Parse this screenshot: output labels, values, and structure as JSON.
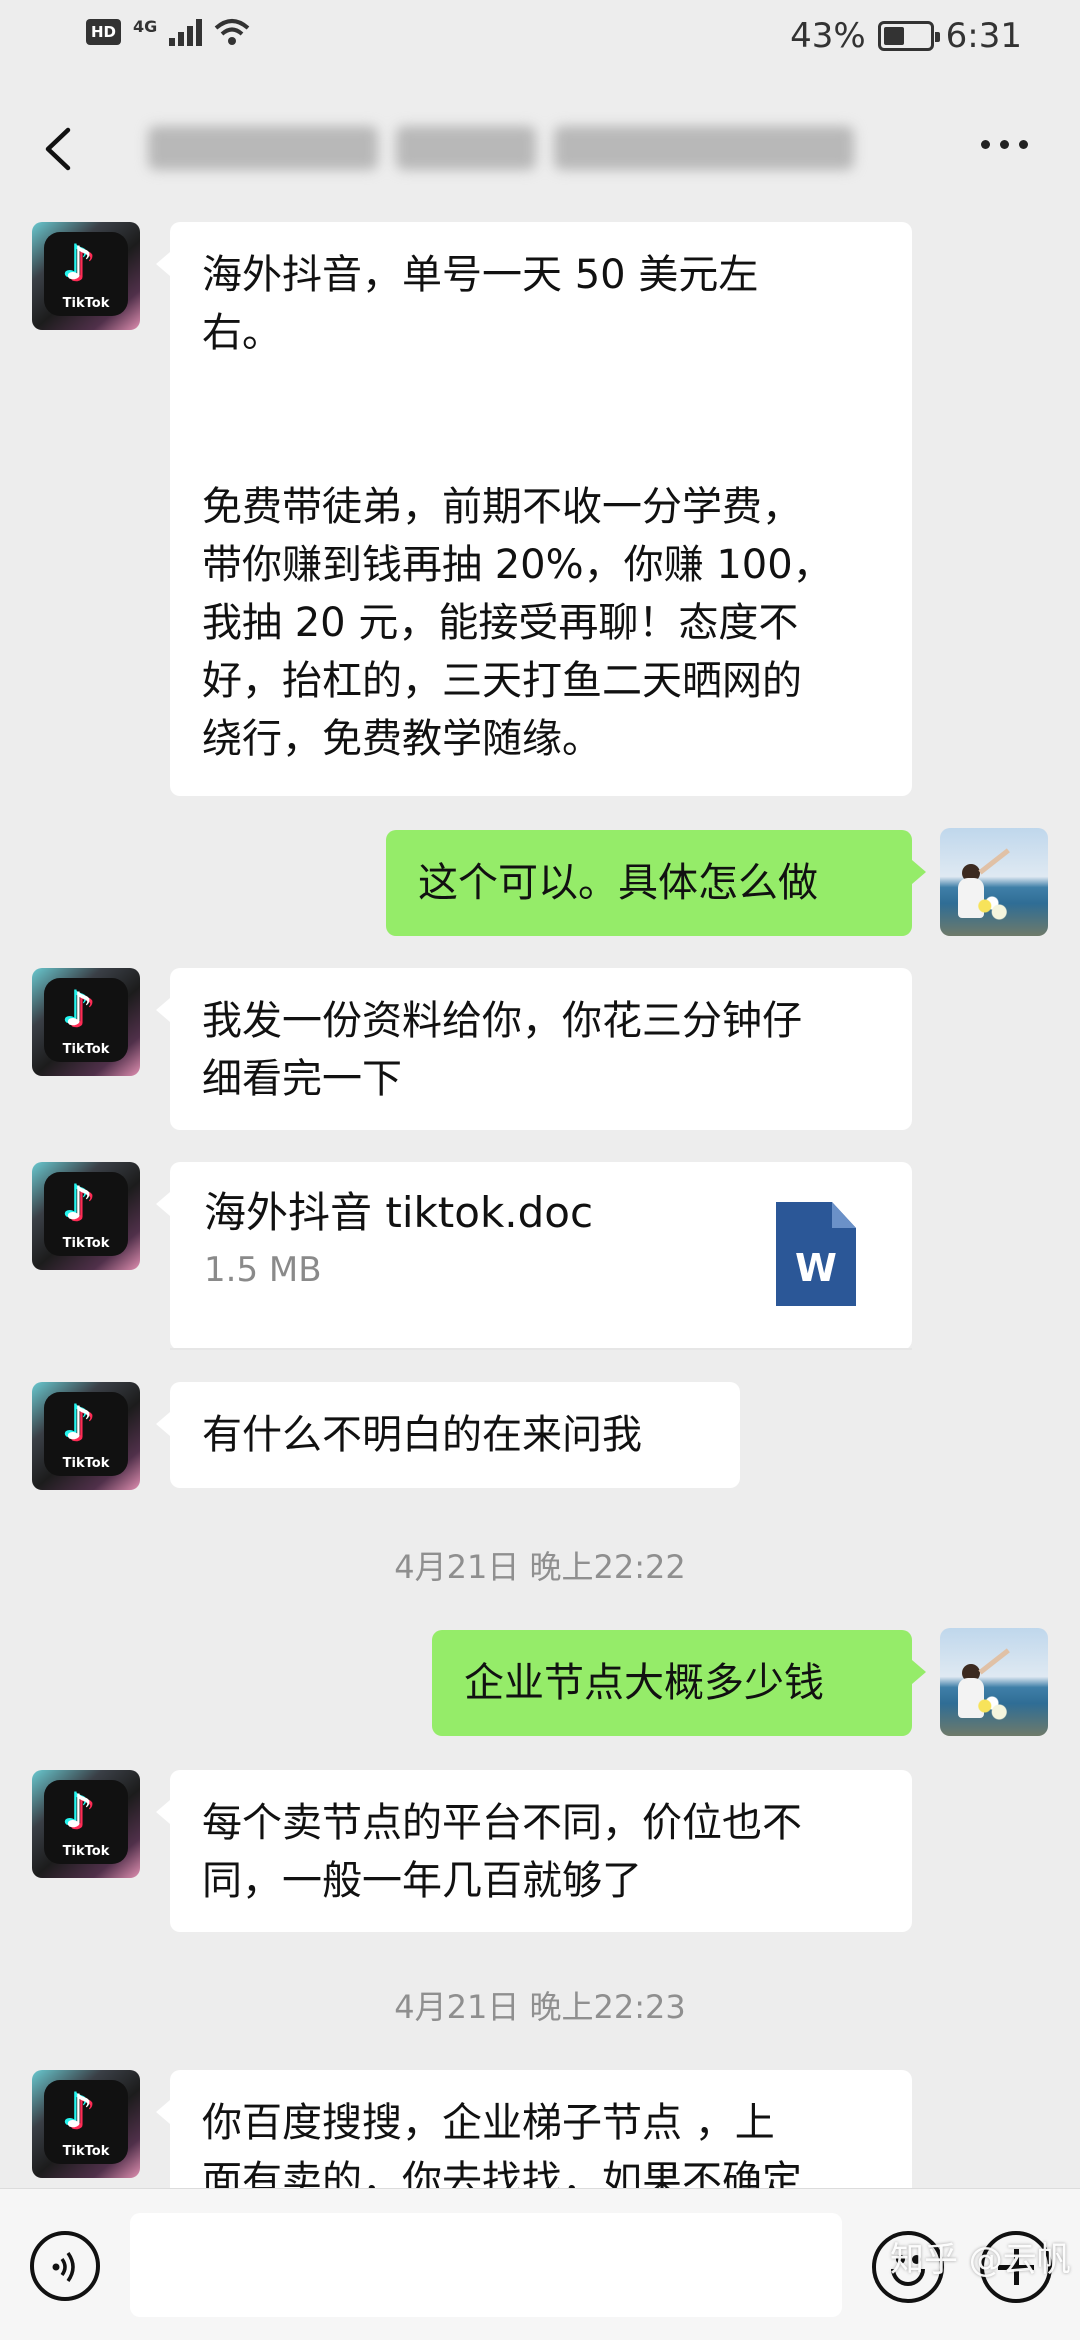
{
  "status_bar": {
    "hd": "HD",
    "network": "4G",
    "battery": "43%",
    "time": "6:31"
  },
  "header": {
    "title": ""
  },
  "messages": {
    "m1": "海外抖音，单号一天 50 美元左\n右。\n\n\n免费带徒弟，前期不收一分学费，\n带你赚到钱再抽 20%，你赚 100，\n我抽 20 元，能接受再聊！态度不\n好，抬杠的，三天打鱼二天晒网的\n绕行，免费教学随缘。",
    "m2": "这个可以。具体怎么做",
    "m3": "我发一份资料给你，你花三分钟仔\n细看完一下",
    "file_name": "海外抖音 tiktok.doc",
    "file_size": "1.5 MB",
    "file_icon_letter": "W",
    "m5": "有什么不明白的在来问我",
    "ts1": "4月21日 晚上22:22",
    "m6": "企业节点大概多少钱",
    "m7": "每个卖节点的平台不同，价位也不\n同，一般一年几百就够了",
    "ts2": "4月21日 晚上22:23",
    "m8": "你百度搜搜，企业梯子节点 ，上\n面有卖的，你去找找，如果不确定"
  },
  "avatar_label": "TikTok",
  "input_bar": {
    "placeholder": ""
  },
  "watermark": "知乎 @云帆",
  "colors": {
    "background": "#ededed",
    "incoming_bubble": "#ffffff",
    "outgoing_bubble": "#95ec69",
    "timestamp": "#8f8f8f",
    "doc_icon": "#2b5797"
  },
  "icons": [
    "back-arrow-icon",
    "more-icon",
    "voice-icon",
    "emoji-icon",
    "plus-icon",
    "word-doc-icon"
  ]
}
